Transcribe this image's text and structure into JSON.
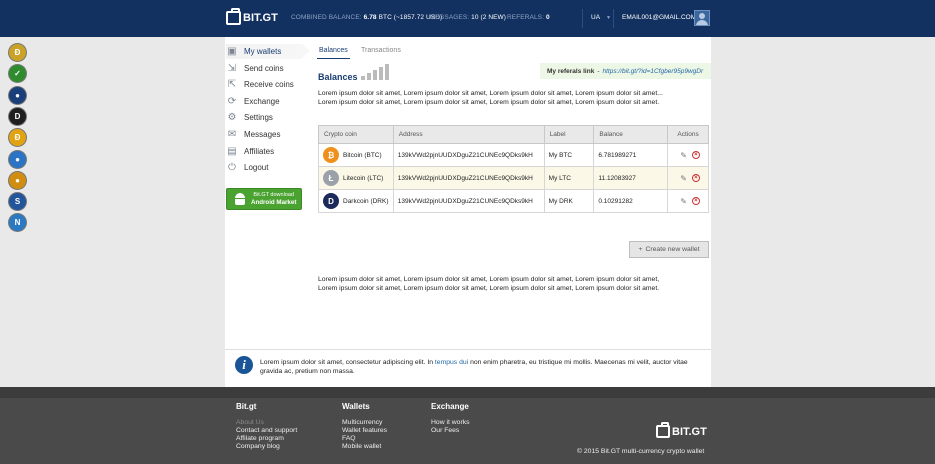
{
  "header": {
    "brand": "BIT.GT",
    "combined_label": "COMBINED BALANCE:",
    "combined_value": "6.78",
    "combined_unit": "BTC (~1857.72 USD)",
    "messages_label": "MESSAGES:",
    "messages_value": "10 (2 NEW)",
    "referals_label": "REFERALS:",
    "referals_value": "0",
    "language": "UA",
    "email": "EMAIL001@GMAIL.COM"
  },
  "rail_coins": [
    {
      "glyph": "Ð",
      "color": "#c9a227"
    },
    {
      "glyph": "✓",
      "color": "#2e8b2e"
    },
    {
      "glyph": "●",
      "color": "#1b3f7a"
    },
    {
      "glyph": "D",
      "color": "#1f1f1f"
    },
    {
      "glyph": "Ð",
      "color": "#e2a313"
    },
    {
      "glyph": "●",
      "color": "#2b73c4"
    },
    {
      "glyph": "●",
      "color": "#d18d10"
    },
    {
      "glyph": "S",
      "color": "#23559a"
    },
    {
      "glyph": "N",
      "color": "#2b79c2"
    }
  ],
  "menu": [
    {
      "label": "My wallets",
      "icon": "wallet-icon"
    },
    {
      "label": "Send coins",
      "icon": "send-icon"
    },
    {
      "label": "Receive coins",
      "icon": "receive-icon"
    },
    {
      "label": "Exchange",
      "icon": "exchange-icon"
    },
    {
      "label": "Settings",
      "icon": "gear-icon"
    },
    {
      "label": "Messages",
      "icon": "message-icon"
    },
    {
      "label": "Affiliates",
      "icon": "affiliates-icon"
    },
    {
      "label": "Logout",
      "icon": "power-icon"
    }
  ],
  "android": {
    "line1": "Bit.GT download",
    "line2": "Android Market"
  },
  "tabs": [
    "Balances",
    "Transactions"
  ],
  "section_title": "Balances",
  "referal": {
    "label": "My referals link",
    "sep": "-",
    "url": "https://bit.gt/?id=1Cfgber95p9wgDr"
  },
  "intro_text": "Lorem ipsum dolor sit amet, Lorem ipsum dolor sit amet, Lorem ipsum dolor sit amet, Lorem ipsum dolor sit amet... Lorem ipsum dolor sit amet, Lorem ipsum dolor sit amet, Lorem ipsum dolor sit amet, Lorem ipsum dolor sit amet.",
  "table": {
    "headers": [
      "Crypto coin",
      "Address",
      "Label",
      "Balance",
      "Actions"
    ],
    "rows": [
      {
        "coin": "Bitcoin (BTC)",
        "glyph": "₿",
        "color": "#f0901c",
        "address": "139kVWd2pjnUUDXDguZ21CUNEc9QDks9kH",
        "label": "My BTC",
        "balance": "6.781989271"
      },
      {
        "coin": "Litecoin (LTC)",
        "glyph": "Ł",
        "color": "#9aa1a8",
        "address": "139kVWd2pjnUUDXDguZ21CUNEc9QDks9kH",
        "label": "My LTC",
        "balance": "11.12083927"
      },
      {
        "coin": "Darkcoin (DRK)",
        "glyph": "D",
        "color": "#1b2a5a",
        "address": "139kVWd2pjnUUDXDguZ21CUNEc9QDks9kH",
        "label": "My DRK",
        "balance": "0.10291282"
      }
    ]
  },
  "create_wallet": "Create new wallet",
  "bottom_text": "Lorem ipsum dolor sit amet, Lorem ipsum dolor sit amet, Lorem ipsum dolor sit amet, Lorem ipsum dolor sit amet, Lorem ipsum dolor sit amet, Lorem ipsum dolor sit amet, Lorem ipsum dolor sit amet, Lorem ipsum dolor sit amet.",
  "info": {
    "pre": "Lorem ipsum dolor sit amet, consectetur adipiscing elit. In",
    "link": "tempus dui",
    "post": "non enim pharetra, eu tristique mi mollis. Maecenas mi velit, auctor vitae gravida ac, pretium non massa."
  },
  "footer": {
    "col1": {
      "title": "Bit.gt",
      "links": [
        "About Us",
        "Contact and support",
        "Affilate program",
        "Company blog"
      ]
    },
    "col2": {
      "title": "Wallets",
      "links": [
        "Multicurrency",
        "Wallet features",
        "FAQ",
        "Mobile wallet"
      ]
    },
    "col3": {
      "title": "Exchange",
      "links": [
        "How it works",
        "Our Fees"
      ]
    },
    "brand": "BIT.GT",
    "copyright": "© 2015 Bit.GT multi-currency crypto wallet"
  }
}
